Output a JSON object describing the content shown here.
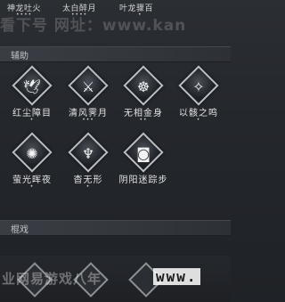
{
  "top_skills": [
    {
      "label": "神龙吐火",
      "dots": "••••"
    },
    {
      "label": "太白醉月",
      "dots": "••••"
    },
    {
      "label": "叶龙骤百",
      "dots": "•"
    }
  ],
  "watermark_top": "看下号  网址：www.kan",
  "section_support": {
    "title": "辅助"
  },
  "support_skills": [
    {
      "name": "红尘障目",
      "icon": "bird-icon",
      "glyph": "🕊",
      "dots": "•"
    },
    {
      "name": "清风霁月",
      "icon": "swords-icon",
      "glyph": "⚔",
      "dots": "•••"
    },
    {
      "name": "无相金身",
      "icon": "buddha-icon",
      "glyph": "☸",
      "dots": "••"
    },
    {
      "name": "以骸之鸣",
      "icon": "crane-icon",
      "glyph": "✧",
      "dots": "•"
    },
    {
      "name": "萤光晖夜",
      "icon": "swirl-icon",
      "glyph": "✺",
      "dots": "•"
    },
    {
      "name": "杳无形",
      "icon": "figure-icon",
      "glyph": "♆",
      "dots": "•"
    },
    {
      "name": "阴阳迷踪步",
      "icon": "mask-icon",
      "glyph": "◙",
      "dots": ""
    }
  ],
  "section_moves": {
    "title": "棍戏"
  },
  "watermark_bottom": "业网易游戏八年",
  "watermark_url": "www."
}
